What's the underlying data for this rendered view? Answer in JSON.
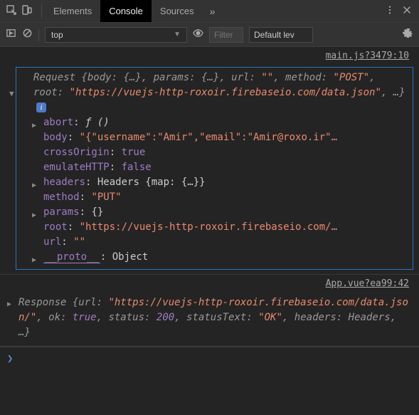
{
  "topbar": {
    "tabs": [
      "Elements",
      "Console",
      "Sources"
    ],
    "active_tab": "Console",
    "more": "»"
  },
  "ctrl": {
    "context": "top",
    "filter_ph": "Filter",
    "level": "Default lev"
  },
  "log1": {
    "src": "main.js?3479:10",
    "summary_pre": "Request {body: ",
    "summary_brace": "{…}",
    "summary_mid1": ", params: ",
    "summary_mid2": ", url: ",
    "summary_url": "\"\"",
    "summary_mid3": ", method: ",
    "summary_method": "\"POST\"",
    "summary_mid4": ", root: ",
    "summary_root": "\"https://vuejs-http-roxoir.firebaseio.com/data.json\"",
    "summary_end": ", …}",
    "abort_k": "abort",
    "abort_v": "ƒ ()",
    "body_k": "body",
    "body_v": "\"{\"username\":\"Amir\",\"email\":\"Amir@roxo.ir\"…",
    "cross_k": "crossOrigin",
    "cross_v": "true",
    "emu_k": "emulateHTTP",
    "emu_v": "false",
    "headers_k": "headers",
    "headers_v": "Headers {map: {…}}",
    "method_k": "method",
    "method_v": "\"PUT\"",
    "params_k": "params",
    "params_v": "{}",
    "root_k": "root",
    "root_v": "\"https://vuejs-http-roxoir.firebaseio.com/…",
    "url_k": "url",
    "url_v": "\"\"",
    "proto_k": "__proto__",
    "proto_v": "Object"
  },
  "log2": {
    "src": "App.vue?ea99:42",
    "pre": "Response {url: ",
    "url": "\"https://vuejs-http-roxoir.firebaseio.com/data.json/\"",
    "mid1": ", ok: ",
    "ok": "true",
    "mid2": ", status: ",
    "status": "200",
    "mid3": ", statusText: ",
    "st_text": "\"OK\"",
    "mid4": ", headers: Headers, …}"
  },
  "prompt": "❯"
}
